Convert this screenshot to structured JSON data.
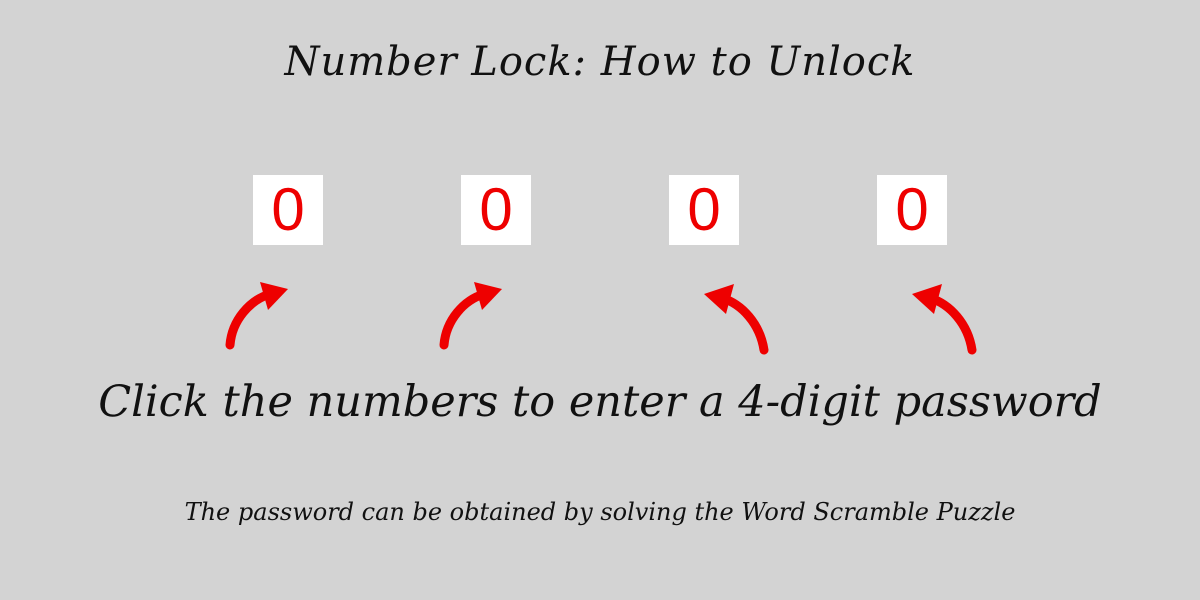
{
  "title": "Number Lock: How to Unlock",
  "lock": {
    "digits": [
      {
        "value": "0"
      },
      {
        "value": "0"
      },
      {
        "value": "0"
      },
      {
        "value": "0"
      }
    ]
  },
  "instruction": "Click the numbers to enter a 4-digit password",
  "hint": "The password can be obtained by solving the Word Scramble Puzzle",
  "colors": {
    "background": "#d3d3d3",
    "digit_box": "#ffffff",
    "digit_text": "#ee0000",
    "arrow": "#ee0000",
    "text": "#111111"
  },
  "icons": [
    "curved-arrow-up-right-icon",
    "curved-arrow-up-left-icon"
  ]
}
